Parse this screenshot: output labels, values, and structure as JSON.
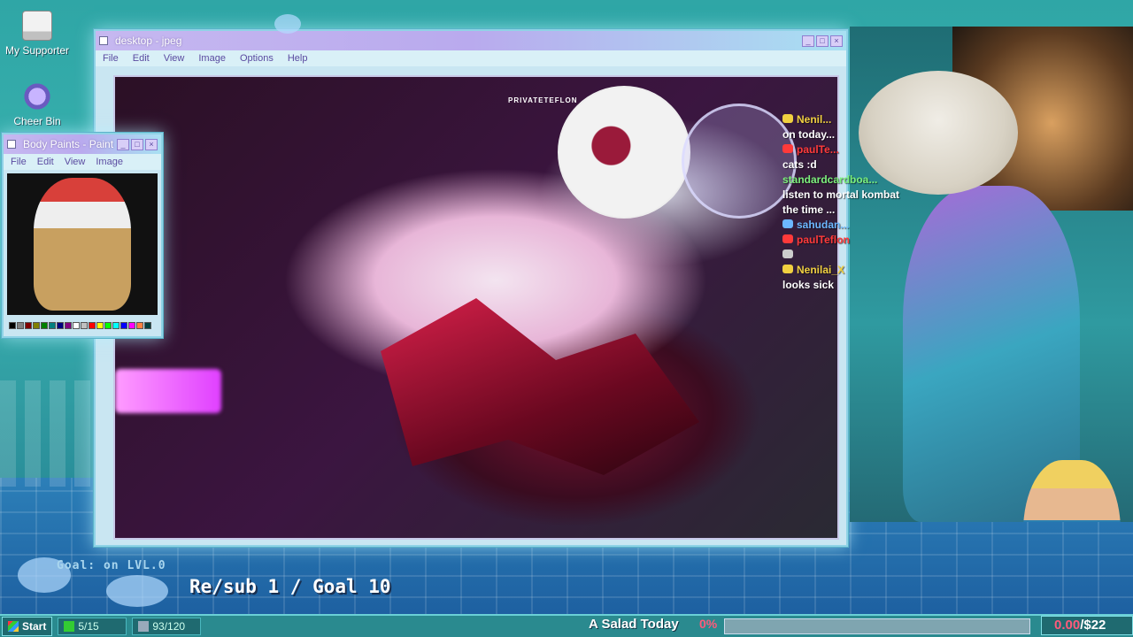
{
  "desktop": {
    "icons": [
      {
        "label": "My Supporter",
        "icon": "computer-icon"
      },
      {
        "label": "Cheer Bin",
        "icon": "recycle-bin-icon"
      }
    ]
  },
  "viewer_window": {
    "title": "desktop - jpeg",
    "menu": [
      "File",
      "Edit",
      "View",
      "Image",
      "Options",
      "Help"
    ],
    "watermark": "PRIVATETEFLON"
  },
  "paint_window": {
    "title": "Body Paints - Paint",
    "menu": [
      "File",
      "Edit",
      "View",
      "Image"
    ],
    "palette_colors": [
      "#000000",
      "#808080",
      "#800000",
      "#808000",
      "#008000",
      "#008080",
      "#000080",
      "#800080",
      "#ffffff",
      "#c0c0c0",
      "#ff0000",
      "#ffff00",
      "#00ff00",
      "#00ffff",
      "#0000ff",
      "#ff00ff",
      "#ff8040",
      "#004040"
    ]
  },
  "chat": [
    {
      "user": "Nenil...",
      "user_color": "#f0d040",
      "message": "",
      "badge": "heart-icon"
    },
    {
      "user": "",
      "message": "on today...",
      "msg_color": "#ffffff"
    },
    {
      "user": "paulTe...",
      "user_color": "#ff3a3a",
      "message": "",
      "badge": "new-icon"
    },
    {
      "user": "",
      "message": "cats :d",
      "msg_color": "#ffffff"
    },
    {
      "user": "standardcardboa...",
      "user_color": "#7cf07c",
      "message": ""
    },
    {
      "user": "",
      "message": "listen to mortal kombat",
      "msg_color": "#ffffff"
    },
    {
      "user": "",
      "message": "the time ...",
      "msg_color": "#ffffff"
    },
    {
      "user": "sahudan...",
      "user_color": "#6cb8ff",
      "message": "",
      "badge": "rainbow-icon"
    },
    {
      "user": "paulTeflon",
      "user_color": "#ff3a3a",
      "message": "",
      "badge": "new-icon"
    },
    {
      "user": "",
      "message": "",
      "msg_color": "#ffffff",
      "badge": "unicorn-icon"
    },
    {
      "user": "Nenilai_X",
      "user_color": "#f0d040",
      "message": "",
      "badge": "heart-icon"
    },
    {
      "user": "",
      "message": "looks sick",
      "msg_color": "#ffffff"
    }
  ],
  "goal": {
    "title": "Goal: on LVL.0",
    "label": "Re/sub 1 / Goal 10"
  },
  "taskbar": {
    "start_label": "Start",
    "slot1": "5/15",
    "slot2": "93/120",
    "salad_label": "A Salad Today",
    "percent_label": "0%",
    "progress": 0,
    "money": "0.00",
    "money_goal": "/$22"
  },
  "colors": {
    "accent_pink": "#ff5a7a",
    "window_title": "#c6b8f0",
    "taskbar": "#2a8a8f"
  }
}
